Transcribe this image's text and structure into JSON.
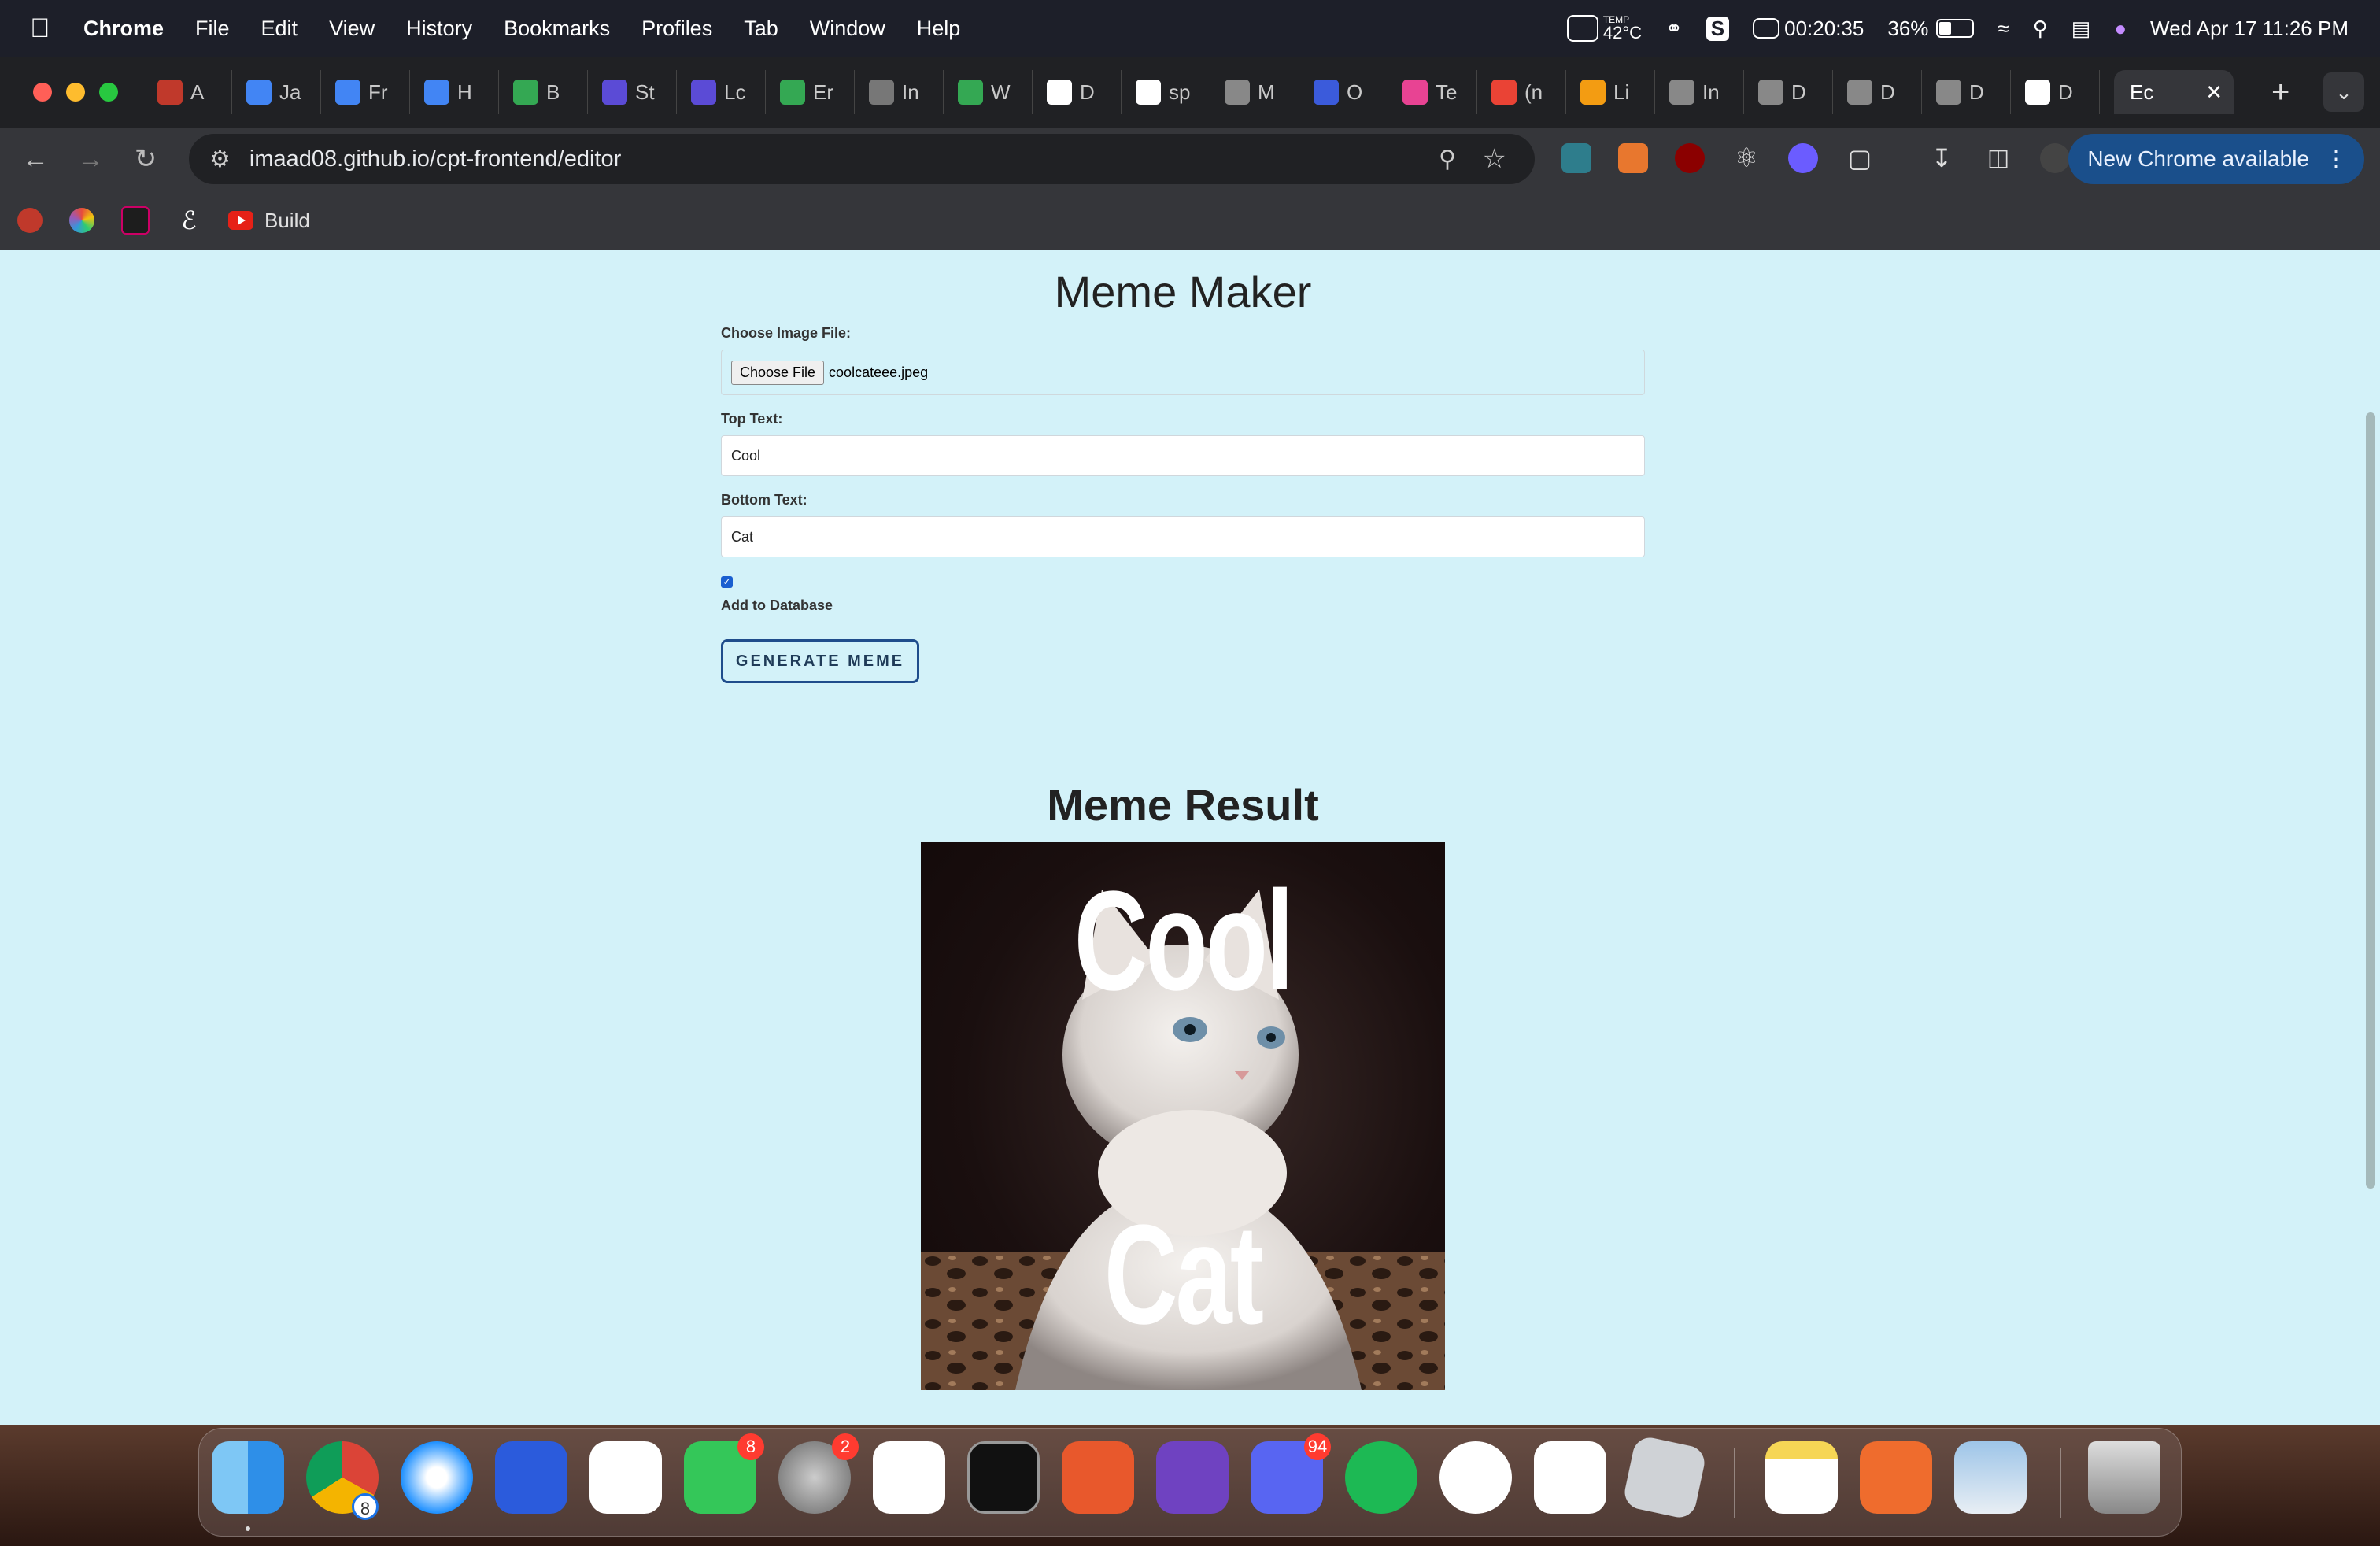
{
  "menubar": {
    "app": "Chrome",
    "menus": [
      "File",
      "Edit",
      "View",
      "History",
      "Bookmarks",
      "Profiles",
      "Tab",
      "Window",
      "Help"
    ],
    "temp_label": "TEMP",
    "temp_value": "42°C",
    "timer": "00:20:35",
    "battery_percent": "36%",
    "battery_level": 0.36,
    "datetime": "Wed Apr 17  11:26 PM"
  },
  "tabs": [
    {
      "label": "A"
    },
    {
      "label": "Ja"
    },
    {
      "label": "Fr"
    },
    {
      "label": "H"
    },
    {
      "label": "B"
    },
    {
      "label": "St"
    },
    {
      "label": "Lc"
    },
    {
      "label": "Er"
    },
    {
      "label": "In"
    },
    {
      "label": "W"
    },
    {
      "label": "D"
    },
    {
      "label": "sp"
    },
    {
      "label": "M"
    },
    {
      "label": "O"
    },
    {
      "label": "Te"
    },
    {
      "label": "(n"
    },
    {
      "label": "Li"
    },
    {
      "label": "In"
    },
    {
      "label": "D"
    },
    {
      "label": "D"
    },
    {
      "label": "D"
    },
    {
      "label": "D"
    }
  ],
  "active_tab": {
    "label": "Ec"
  },
  "toolbar": {
    "url": "imaad08.github.io/cpt-frontend/editor",
    "update_button": "New Chrome available"
  },
  "bookmarks": {
    "build": "Build"
  },
  "page": {
    "title": "Meme Maker",
    "file_label": "Choose Image File:",
    "file_button": "Choose File",
    "file_name": "coolcateee.jpeg",
    "top_label": "Top Text:",
    "top_value": "Cool",
    "bottom_label": "Bottom Text:",
    "bottom_value": "Cat",
    "db_checked": true,
    "db_label": "Add to Database",
    "generate_button": "GENERATE MEME",
    "result_title": "Meme Result",
    "meme_top": "Cool",
    "meme_bottom": "Cat"
  },
  "dock": {
    "chrome_badge": "8",
    "messages_badge": "8",
    "settings_badge": "2",
    "discord_badge": "94"
  }
}
